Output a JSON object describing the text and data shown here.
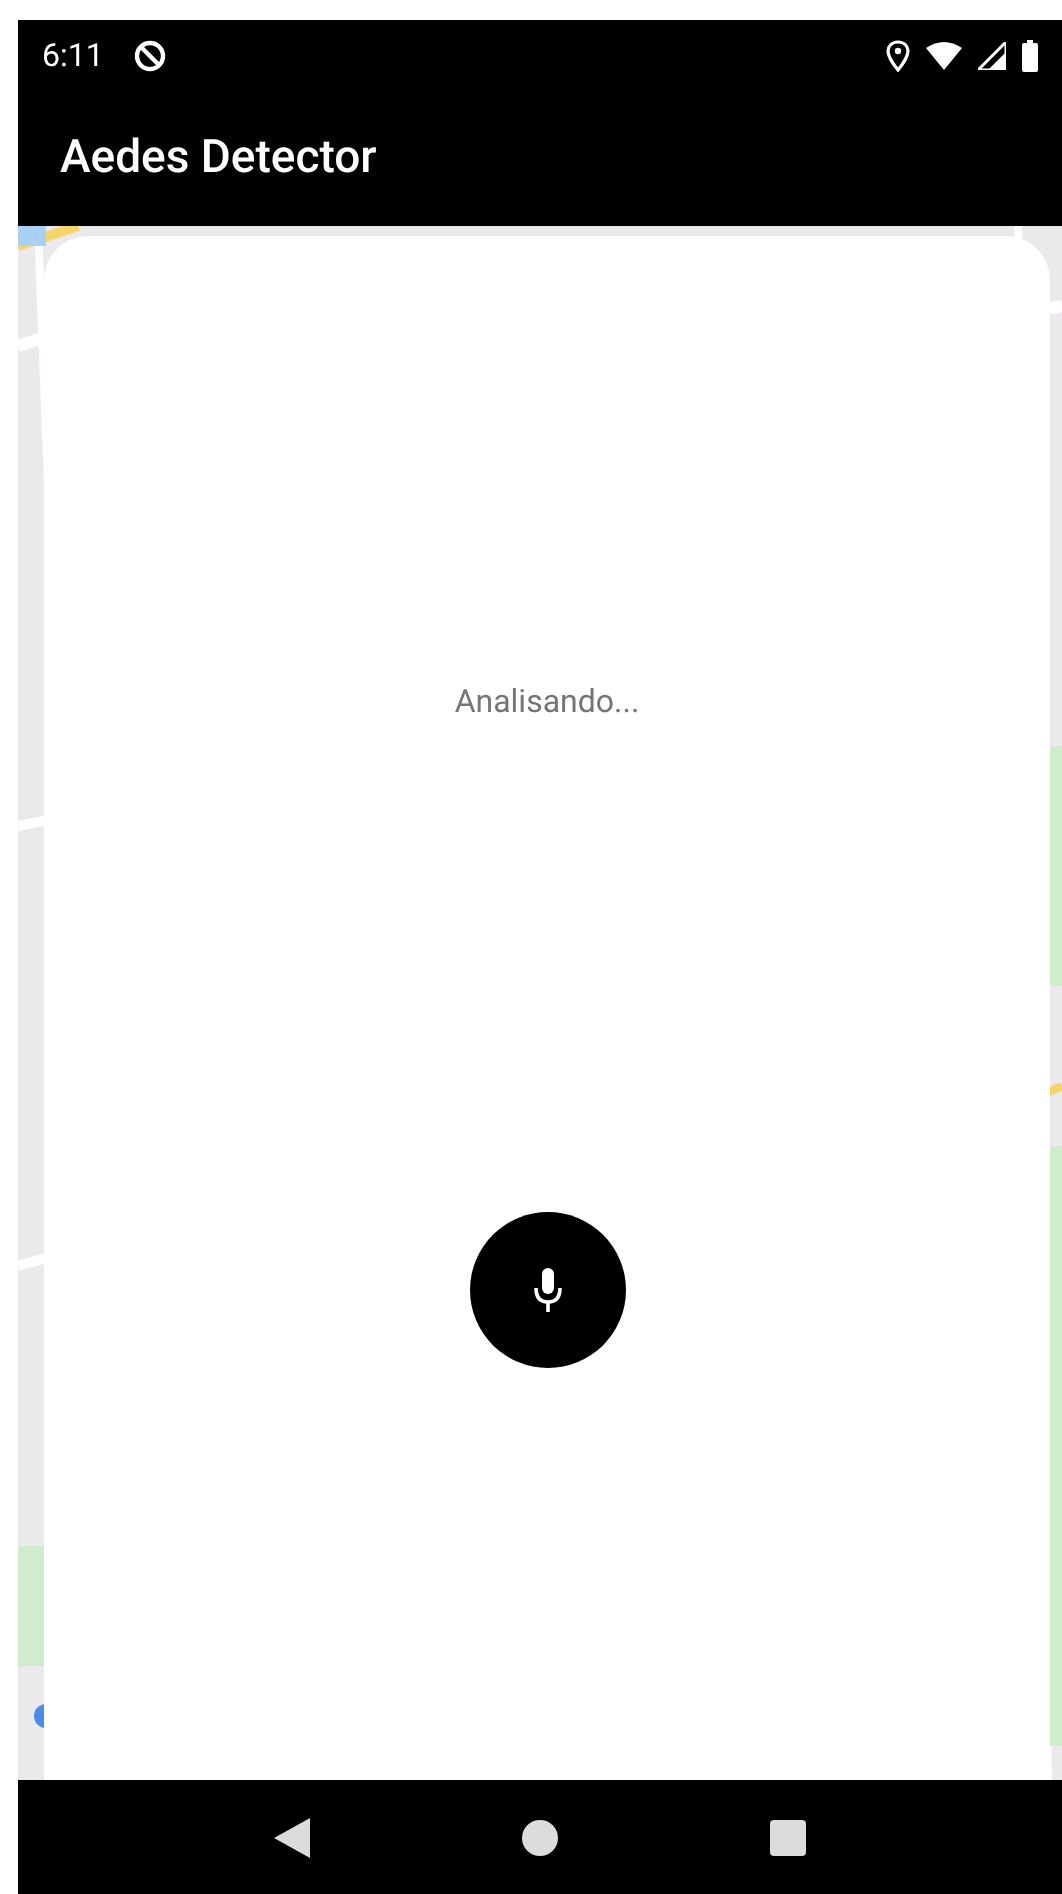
{
  "status_bar": {
    "time": "6:11"
  },
  "app_bar": {
    "title": "Aedes Detector"
  },
  "analysis": {
    "status": "Analisando..."
  }
}
